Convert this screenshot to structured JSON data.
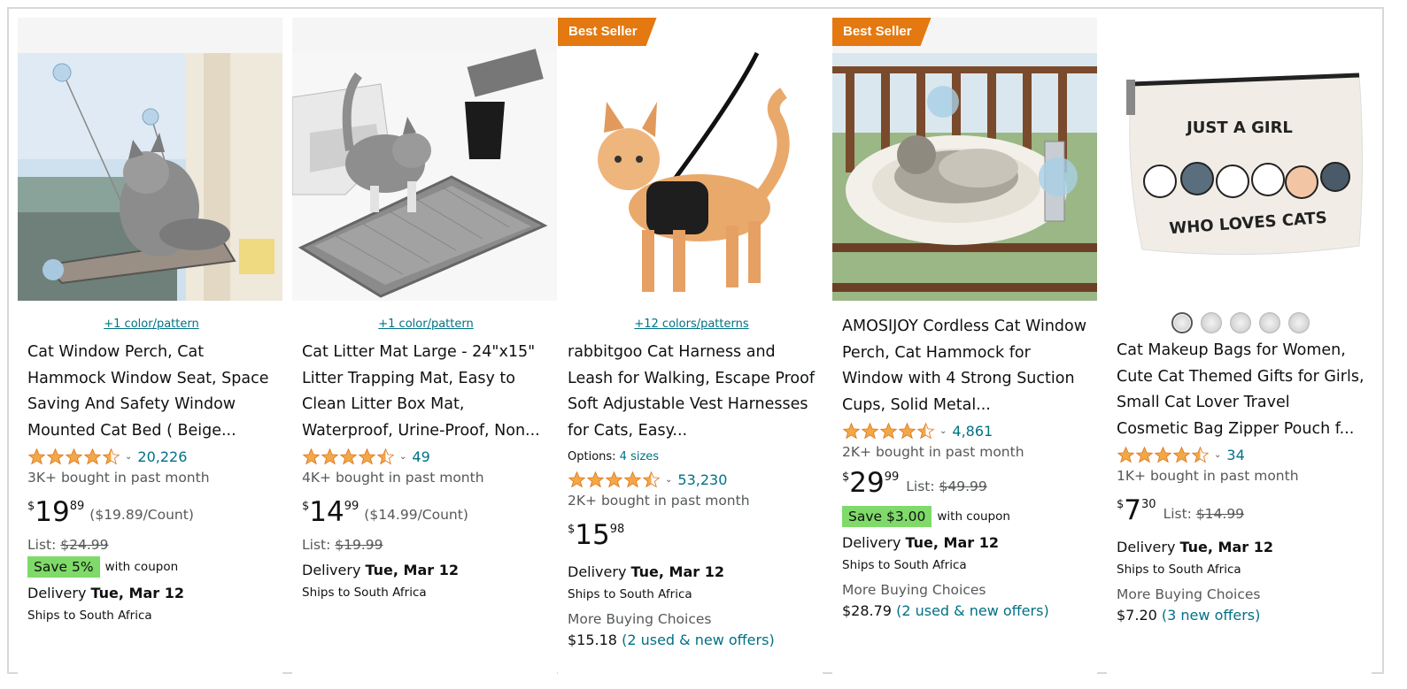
{
  "products": [
    {
      "badge": "",
      "variant_link": "+1 color/pattern",
      "title": "Cat Window Perch, Cat Hammock Window Seat, Space Saving And Safety Window Mounted Cat Bed ( Beige...",
      "rating": 4.5,
      "review_count": "20,226",
      "bought": "3K+ bought in past month",
      "price_symbol": "$",
      "price_whole": "19",
      "price_fraction": "89",
      "unit_price": "($19.89/Count)",
      "list_label": "List: ",
      "list_price": "$24.99",
      "coupon_save": "Save 5%",
      "coupon_with": "with coupon",
      "delivery_label": "Delivery ",
      "delivery_date": "Tue, Mar 12",
      "ships": "Ships to South Africa",
      "image_icon": "cat-window-perch-image"
    },
    {
      "badge": "",
      "variant_link": "+1 color/pattern",
      "title": "Cat Litter Mat Large - 24\"x15\" Litter Trapping Mat, Easy to Clean Litter Box Mat, Waterproof, Urine-Proof, Non...",
      "rating": 4.5,
      "review_count": "49",
      "bought": "4K+ bought in past month",
      "price_symbol": "$",
      "price_whole": "14",
      "price_fraction": "99",
      "unit_price": "($14.99/Count)",
      "list_label": "List: ",
      "list_price": "$19.99",
      "delivery_label": "Delivery ",
      "delivery_date": "Tue, Mar 12",
      "ships": "Ships to South Africa",
      "image_icon": "cat-litter-mat-image"
    },
    {
      "badge": "Best Seller",
      "variant_link": "+12 colors/patterns",
      "title": "rabbitgoo Cat Harness and Leash for Walking, Escape Proof Soft Adjustable Vest Harnesses for Cats, Easy...",
      "options_label": "Options: ",
      "options_value": "4 sizes",
      "rating": 4.5,
      "review_count": "53,230",
      "bought": "2K+ bought in past month",
      "price_symbol": "$",
      "price_whole": "15",
      "price_fraction": "98",
      "delivery_label": "Delivery ",
      "delivery_date": "Tue, Mar 12",
      "ships": "Ships to South Africa",
      "more_buying": "More Buying Choices",
      "more_price": "$15.18",
      "more_offers": "(2 used & new offers)",
      "image_icon": "cat-harness-image"
    },
    {
      "badge": "Best Seller",
      "title": "AMOSIJOY Cordless Cat Window Perch, Cat Hammock for Window with 4 Strong Suction Cups, Solid Metal...",
      "rating": 4.5,
      "review_count": "4,861",
      "bought": "2K+ bought in past month",
      "price_symbol": "$",
      "price_whole": "29",
      "price_fraction": "99",
      "list_label": "List: ",
      "list_price": "$49.99",
      "coupon_save": "Save $3.00",
      "coupon_with": "with coupon",
      "delivery_label": "Delivery ",
      "delivery_date": "Tue, Mar 12",
      "ships": "Ships to South Africa",
      "more_buying": "More Buying Choices",
      "more_price": "$28.79",
      "more_offers": "(2 used & new offers)",
      "image_icon": "cordless-window-perch-image"
    },
    {
      "badge": "",
      "swatches": 5,
      "title": "Cat Makeup Bags for Women, Cute Cat Themed Gifts for Girls, Small Cat Lover Travel Cosmetic Bag Zipper Pouch f...",
      "rating": 4.5,
      "review_count": "34",
      "bought": "1K+ bought in past month",
      "price_symbol": "$",
      "price_whole": "7",
      "price_fraction": "30",
      "list_label": "List: ",
      "list_price": "$14.99",
      "delivery_label": "Delivery ",
      "delivery_date": "Tue, Mar 12",
      "ships": "Ships to South Africa",
      "more_buying": "More Buying Choices",
      "more_price": "$7.20",
      "more_offers": "(3 new offers)",
      "bag_text_line1": "JUST A GIRL",
      "bag_text_line2": "WHO LOVES CATS",
      "image_icon": "cat-makeup-bag-image"
    }
  ],
  "colors": {
    "badge_orange": "#e47911",
    "link_teal": "#007185",
    "star_orange": "#f3a847",
    "coupon_green": "#7fda69",
    "muted_text": "#565959"
  }
}
